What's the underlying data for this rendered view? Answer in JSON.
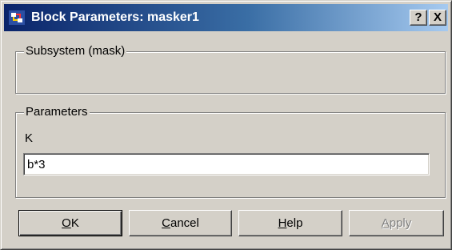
{
  "window": {
    "title": "Block Parameters: masker1",
    "help_glyph": "?",
    "close_glyph": "X",
    "icon": "simulink-block-icon"
  },
  "groups": {
    "mask": {
      "label": "Subsystem (mask)"
    },
    "parameters": {
      "label": "Parameters"
    }
  },
  "parameter": {
    "label": "K",
    "value": "b*3"
  },
  "buttons": {
    "ok": {
      "mnemonic": "O",
      "rest": "K"
    },
    "cancel": {
      "mnemonic": "C",
      "rest": "ancel"
    },
    "help": {
      "mnemonic": "H",
      "rest": "elp"
    },
    "apply": {
      "mnemonic": "A",
      "rest": "pply"
    }
  },
  "colors": {
    "face": "#d4d0c8",
    "title_start": "#0a246a",
    "title_end": "#a6caf0",
    "disabled_text": "#808080"
  }
}
